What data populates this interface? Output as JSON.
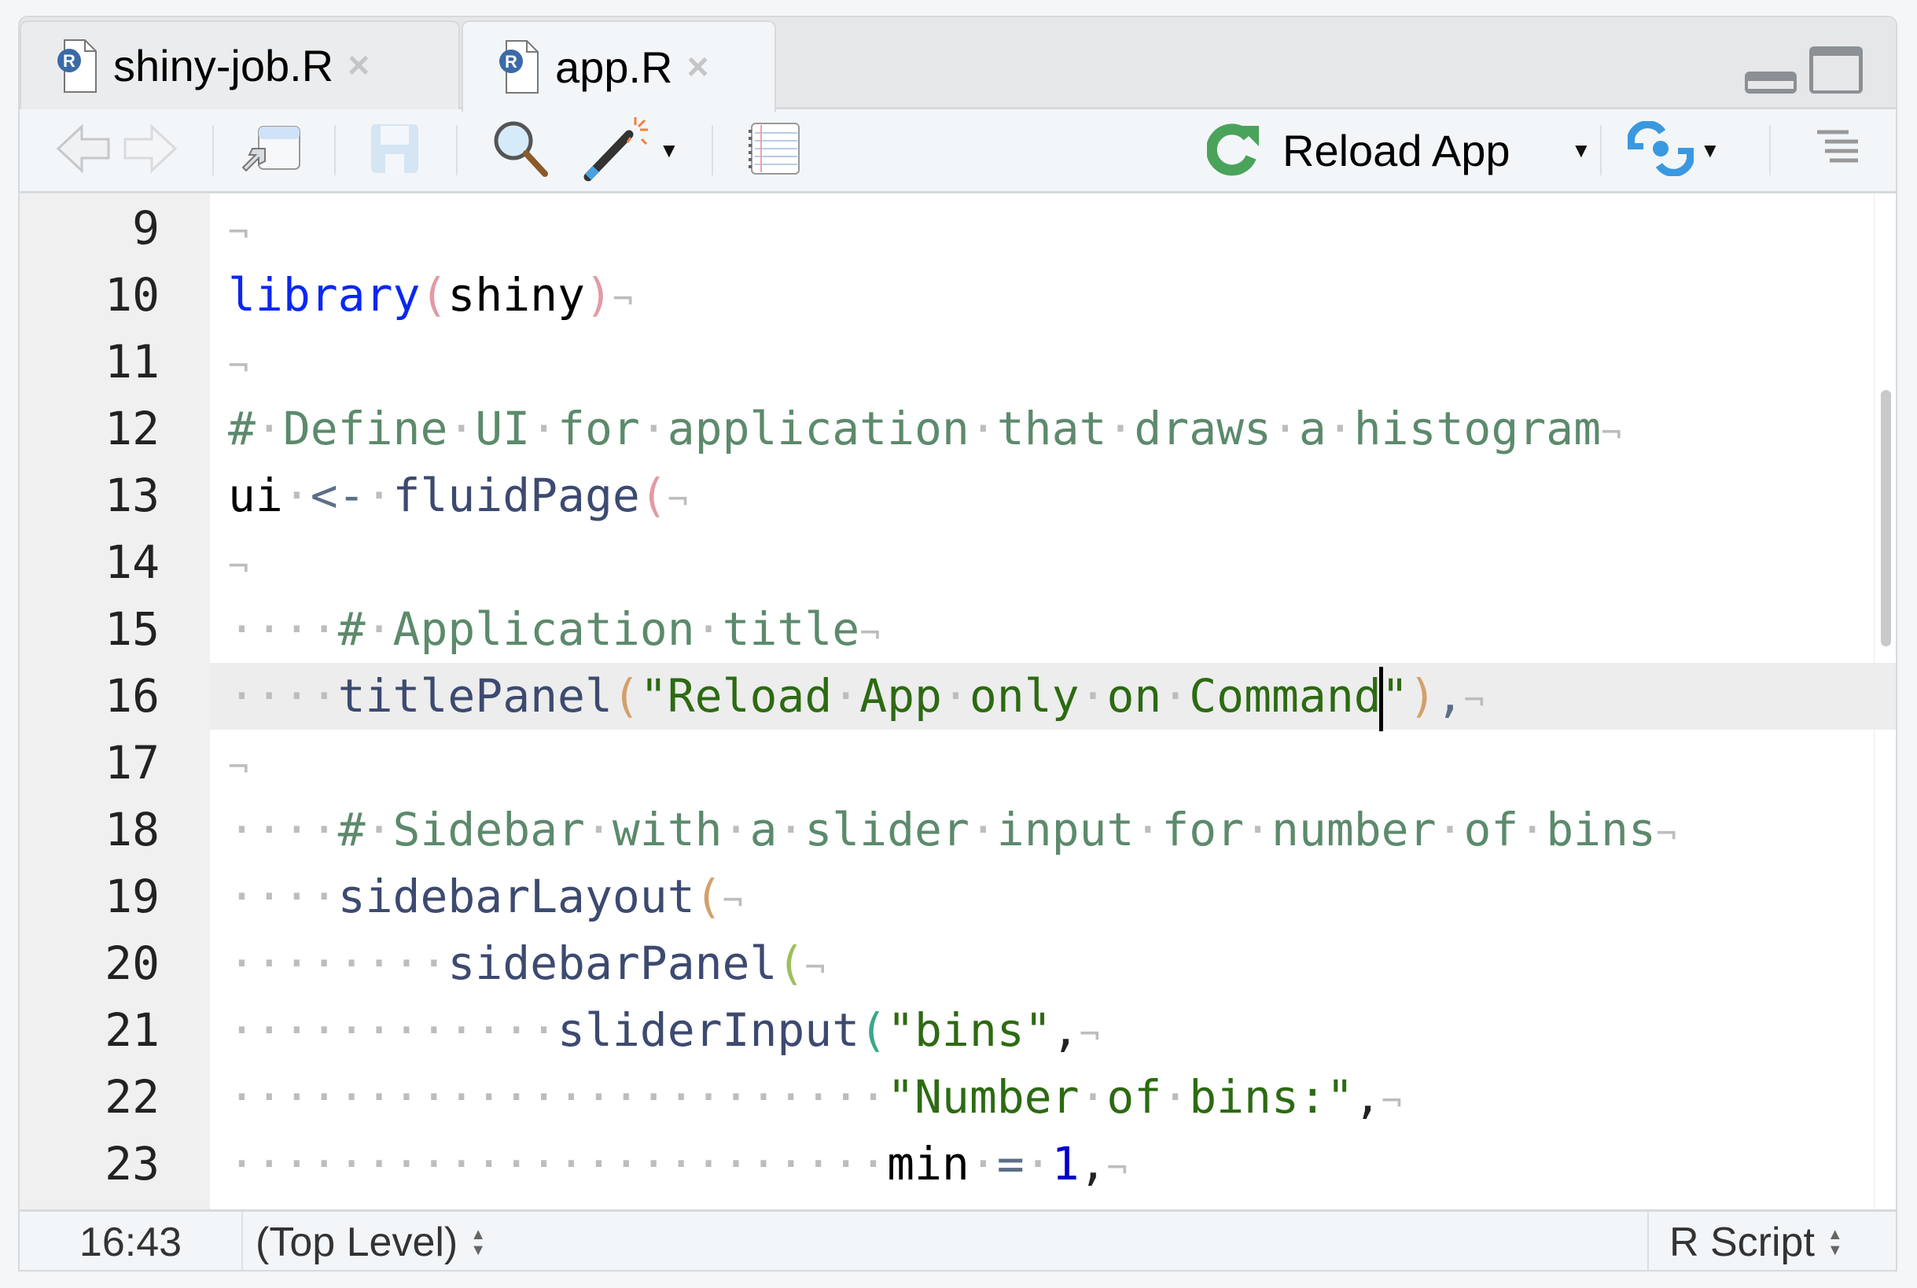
{
  "tabs": [
    {
      "label": "shiny-job.R",
      "close": "×",
      "active": false
    },
    {
      "label": "app.R",
      "close": "×",
      "active": true
    }
  ],
  "toolbar": {
    "reload_label": "Reload App",
    "icons": [
      "back-arrow-icon",
      "forward-arrow-icon",
      "show-in-window-icon",
      "save-icon",
      "search-icon",
      "magic-wand-icon",
      "notebook-icon",
      "reload-icon",
      "publish-icon",
      "outline-icon"
    ]
  },
  "colors": {
    "keyword": "#0a28f0",
    "comment": "#5c8a6c",
    "string": "#2d6a12",
    "function": "#3d4a70",
    "reload_green": "#4aa35a",
    "publish_blue": "#3a98e0",
    "current_line": "#ededed"
  },
  "editor": {
    "current_line": 16,
    "lines": [
      {
        "n": "9",
        "t": [
          [
            "eol",
            "¬"
          ]
        ]
      },
      {
        "n": "10",
        "t": [
          [
            "kw",
            "library"
          ],
          [
            "p1",
            "("
          ],
          [
            "id",
            "shiny"
          ],
          [
            "p1",
            ")"
          ],
          [
            "eol",
            "¬"
          ]
        ]
      },
      {
        "n": "11",
        "t": [
          [
            "eol",
            "¬"
          ]
        ]
      },
      {
        "n": "12",
        "t": [
          [
            "cm",
            "#·Define·UI·for·application·that·draws·a·histogram"
          ],
          [
            "eol",
            "¬"
          ]
        ]
      },
      {
        "n": "13",
        "t": [
          [
            "id",
            "ui"
          ],
          [
            "ws",
            "·"
          ],
          [
            "op",
            "<-"
          ],
          [
            "ws",
            "·"
          ],
          [
            "fn",
            "fluidPage"
          ],
          [
            "p1",
            "("
          ],
          [
            "eol",
            "¬"
          ]
        ]
      },
      {
        "n": "14",
        "t": [
          [
            "eol",
            "¬"
          ]
        ]
      },
      {
        "n": "15",
        "t": [
          [
            "ws",
            "····"
          ],
          [
            "cm",
            "#·Application·title"
          ],
          [
            "eol",
            "¬"
          ]
        ]
      },
      {
        "n": "16",
        "t": [
          [
            "ws",
            "····"
          ],
          [
            "fn",
            "titlePanel"
          ],
          [
            "p2",
            "("
          ],
          [
            "str",
            "\"Reload·App·only·on·Command"
          ],
          [
            "cursor",
            ""
          ],
          [
            "str",
            "\""
          ],
          [
            "p2",
            ")"
          ],
          [
            "pu",
            ","
          ],
          [
            "eol",
            "¬"
          ]
        ]
      },
      {
        "n": "17",
        "t": [
          [
            "eol",
            "¬"
          ]
        ]
      },
      {
        "n": "18",
        "t": [
          [
            "ws",
            "····"
          ],
          [
            "cm",
            "#·Sidebar·with·a·slider·input·for·number·of·bins"
          ],
          [
            "eol",
            "¬"
          ]
        ]
      },
      {
        "n": "19",
        "t": [
          [
            "ws",
            "····"
          ],
          [
            "fn",
            "sidebarLayout"
          ],
          [
            "p2",
            "("
          ],
          [
            "eol",
            "¬"
          ]
        ]
      },
      {
        "n": "20",
        "t": [
          [
            "ws",
            "········"
          ],
          [
            "fn",
            "sidebarPanel"
          ],
          [
            "p3",
            "("
          ],
          [
            "eol",
            "¬"
          ]
        ]
      },
      {
        "n": "21",
        "t": [
          [
            "ws",
            "············"
          ],
          [
            "fn",
            "sliderInput"
          ],
          [
            "p4",
            "("
          ],
          [
            "str",
            "\"bins\""
          ],
          [
            "pu2",
            ","
          ],
          [
            "eol",
            "¬"
          ]
        ]
      },
      {
        "n": "22",
        "t": [
          [
            "ws",
            "························"
          ],
          [
            "str",
            "\"Number·of·bins:\""
          ],
          [
            "pu2",
            ","
          ],
          [
            "eol",
            "¬"
          ]
        ]
      },
      {
        "n": "23",
        "t": [
          [
            "ws",
            "························"
          ],
          [
            "id",
            "min"
          ],
          [
            "ws",
            "·"
          ],
          [
            "op",
            "="
          ],
          [
            "ws",
            "·"
          ],
          [
            "num-t",
            "1"
          ],
          [
            "pu2",
            ","
          ],
          [
            "eol",
            "¬"
          ]
        ]
      }
    ]
  },
  "status": {
    "position": "16:43",
    "scope": "(Top Level)",
    "file_type": "R Script"
  }
}
